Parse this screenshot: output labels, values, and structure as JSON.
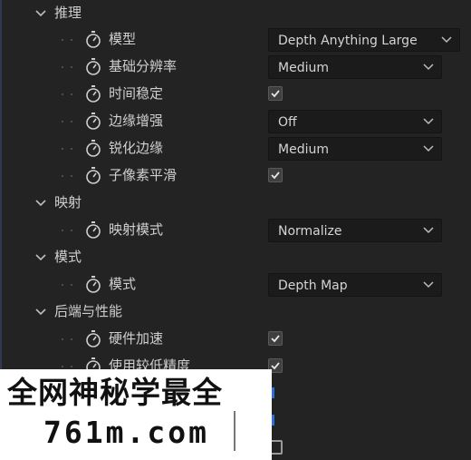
{
  "sections": {
    "inference": {
      "label": "推理",
      "model": {
        "label": "模型",
        "value": "Depth Anything Large"
      },
      "base_resolution": {
        "label": "基础分辨率",
        "value": "Medium"
      },
      "temporal_stability": {
        "label": "时间稳定",
        "checked": true
      },
      "edge_enhance": {
        "label": "边缘增强",
        "value": "Off"
      },
      "sharpen_edges": {
        "label": "锐化边缘",
        "value": "Medium"
      },
      "subpixel_smooth": {
        "label": "子像素平滑",
        "checked": true
      }
    },
    "mapping": {
      "label": "映射",
      "mapping_mode": {
        "label": "映射模式",
        "value": "Normalize"
      }
    },
    "mode": {
      "label": "模式",
      "mode": {
        "label": "模式",
        "value": "Depth Map"
      }
    },
    "backend": {
      "label": "后端与性能",
      "hw_accel": {
        "label": "硬件加速",
        "checked": true
      },
      "lower_precision": {
        "label": "使用较低精度",
        "checked": true
      },
      "last_option": {
        "checked": false
      }
    }
  },
  "watermark": {
    "line1": "全网神秘学最全",
    "line2": "761m.com"
  },
  "colors": {
    "background": "#232323",
    "dropdown_bg": "#1b1b1b",
    "text": "#cfcfcf",
    "accent_blue": "#2d6fd6"
  },
  "icons": {
    "section_toggle": "chevron-down-icon",
    "keyframe": "stopwatch-icon",
    "dropdown": "chevron-down-icon",
    "check": "checkmark-icon"
  }
}
